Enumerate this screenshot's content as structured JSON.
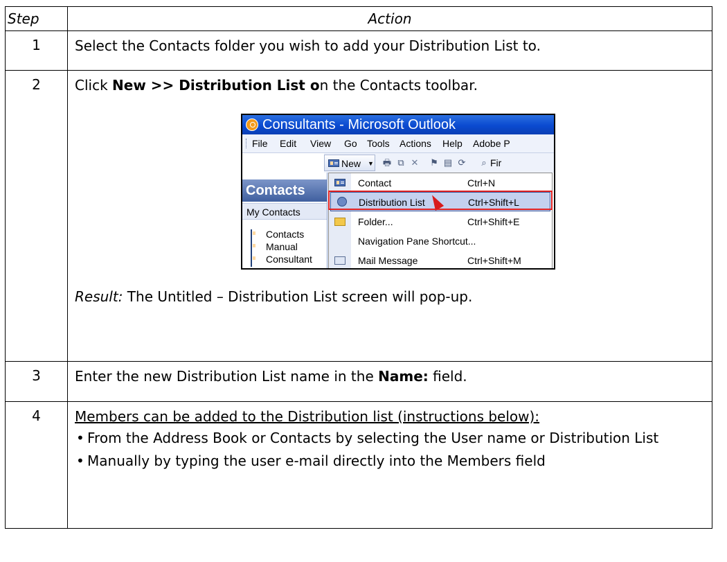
{
  "table": {
    "header_step": "Step",
    "header_action": "Action"
  },
  "steps": [
    {
      "num": "1",
      "text": "Select the Contacts folder you wish to add your Distribution List to."
    },
    {
      "num": "2",
      "pre": "Click ",
      "bold": "New >> Distribution List o",
      "post": "n the Contacts toolbar.",
      "result_label": "Result:",
      "result_text": " The Untitled – Distribution List screen will pop-up."
    },
    {
      "num": "3",
      "pre": "Enter the new Distribution List name in the ",
      "bold": "Name:",
      "post": " field."
    },
    {
      "num": "4",
      "intro": "Members can be added to the Distribution list (instructions below):",
      "bullets": [
        "From the Address Book or Contacts by selecting the User name or Distribution List",
        "Manually by typing the user e-mail directly into the Members field"
      ]
    }
  ],
  "screenshot": {
    "title": "Consultants - Microsoft Outlook",
    "menu": [
      "File",
      "Edit",
      "View",
      "Go",
      "Tools",
      "Actions",
      "Help",
      "Adobe P"
    ],
    "new_button": "New",
    "find_stub": "Fir",
    "nav_header": "Contacts",
    "nav_sub": "My Contacts",
    "nav_items": [
      "Contacts",
      "Manual",
      "Consultant"
    ],
    "dropdown": [
      {
        "label": "Contact",
        "shortcut": "Ctrl+N"
      },
      {
        "label": "Distribution List",
        "shortcut": "Ctrl+Shift+L"
      },
      {
        "label": "Folder...",
        "shortcut": "Ctrl+Shift+E"
      },
      {
        "label": "Navigation Pane Shortcut...",
        "shortcut": ""
      },
      {
        "label": "Mail Message",
        "shortcut": "Ctrl+Shift+M"
      }
    ],
    "colors": {
      "titlebar": "#0a4ad0",
      "highlight": "#c4d1ee",
      "callout": "#e02020",
      "cursor": "#d81b1b"
    }
  }
}
